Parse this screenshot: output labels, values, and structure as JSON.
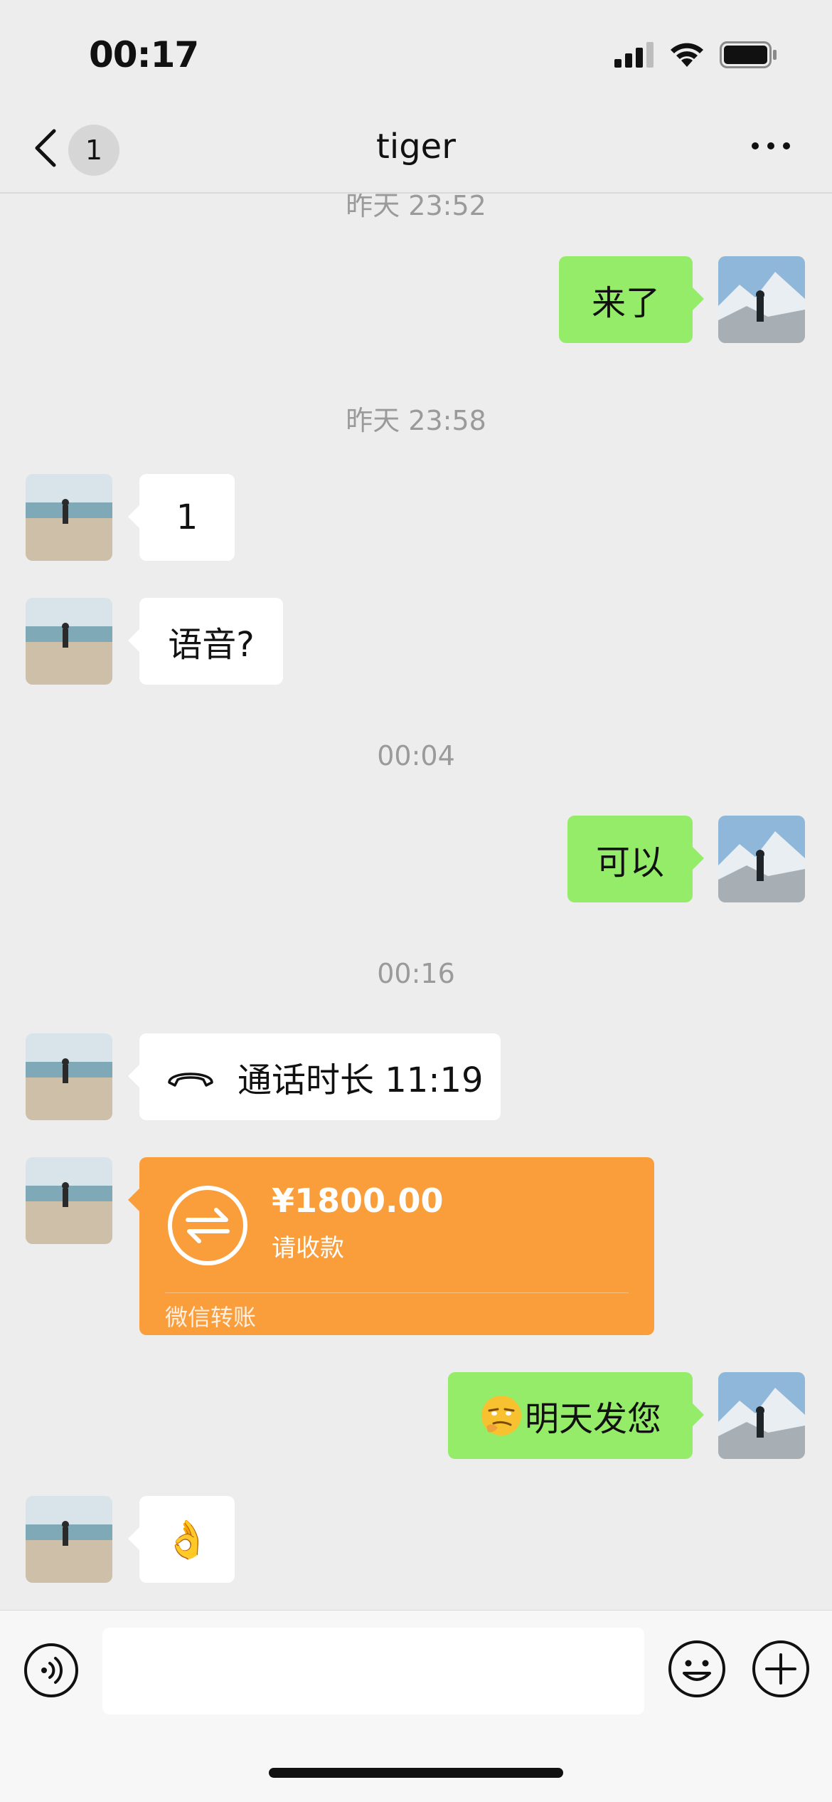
{
  "status_bar": {
    "time": "00:17",
    "icons": [
      "cellular-signal-icon",
      "wifi-icon",
      "battery-icon"
    ]
  },
  "nav": {
    "unread_count": "1",
    "title": "tiger",
    "back_icon": "chevron-left-icon",
    "more_icon": "more-dots-icon"
  },
  "chat": {
    "timestamps": [
      "昨天 23:52",
      "昨天 23:58",
      "00:04",
      "00:16"
    ],
    "messages": [
      {
        "side": "right",
        "text": "来了"
      },
      {
        "side": "left",
        "text": "1"
      },
      {
        "side": "left",
        "text": "语音?"
      },
      {
        "side": "right",
        "text": "可以"
      },
      {
        "side": "left",
        "type": "call",
        "text": "通话时长 11:19",
        "icon": "phone-hangup-icon"
      },
      {
        "side": "left",
        "type": "transfer",
        "amount": "¥1800.00",
        "status": "请收款",
        "footer": "微信转账",
        "icon": "transfer-arrows-icon"
      },
      {
        "side": "right",
        "text": "明天发您",
        "emoji_icon": "smirk-emoji-icon"
      },
      {
        "side": "left",
        "type": "emoji",
        "emoji": "👌"
      }
    ]
  },
  "input_bar": {
    "voice_icon": "voice-icon",
    "emoji_icon": "emoji-face-icon",
    "plus_icon": "plus-circle-icon",
    "text_value": ""
  },
  "colors": {
    "background": "#EDEDED",
    "bubble_self": "#95EC69",
    "bubble_other": "#FFFFFF",
    "transfer": "#FA9D3B"
  }
}
